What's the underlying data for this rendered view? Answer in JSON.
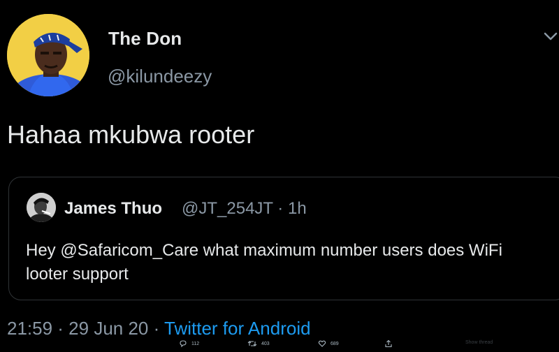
{
  "tweet": {
    "author": {
      "display_name": "The Don",
      "handle": "@kilundeezy"
    },
    "text": "Hahaa mkubwa rooter",
    "menu_icon": "chevron-down-icon"
  },
  "quoted": {
    "author": {
      "display_name": "James Thuo",
      "meta": "@JT_254JT · 1h"
    },
    "text": "Hey @Safaricom_Care what maximum number users does WiFi looter support"
  },
  "footer": {
    "timestamp": "21:59 · 29 Jun 20 · ",
    "source": "Twitter for Android"
  },
  "actions": {
    "replies": "112",
    "retweets": "403",
    "likes": "689",
    "reply_icon": "reply-icon",
    "retweet_icon": "retweet-icon",
    "like_icon": "heart-icon",
    "share_icon": "share-icon",
    "ghost_label": "Show thread"
  },
  "colors": {
    "background": "#000000",
    "text": "#e7e9ea",
    "muted": "#8b98a5",
    "link": "#1d9bf0",
    "border": "#2f3336"
  }
}
